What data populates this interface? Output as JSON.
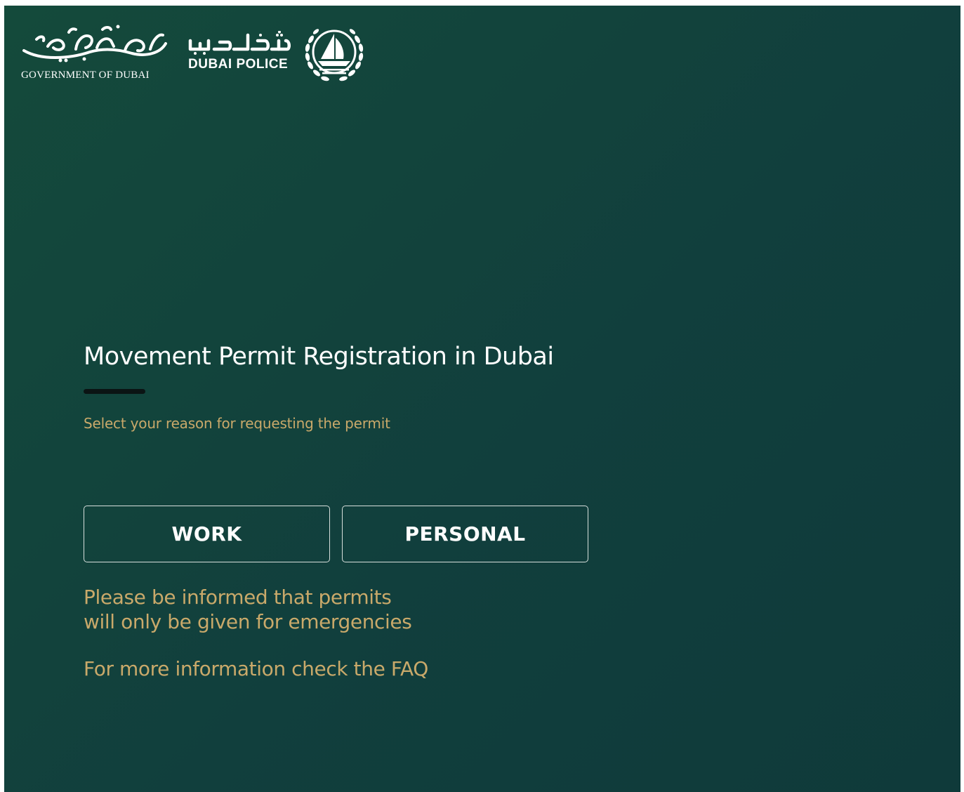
{
  "header": {
    "gov_logo_caption": "GOVERNMENT OF DUBAI",
    "gov_logo_arabic": "حكومة دبي",
    "police_logo_arabic": "شرطة دبي",
    "police_logo_caption": "DUBAI POLICE"
  },
  "main": {
    "title": "Movement Permit Registration in Dubai",
    "subtitle": "Select your reason for requesting the permit",
    "buttons": [
      {
        "label": "WORK"
      },
      {
        "label": "PERSONAL"
      }
    ],
    "notice_line1": "Please be informed that permits",
    "notice_line2": "will only be given for emergencies",
    "faq_text": "For more information check the FAQ"
  },
  "colors": {
    "background": "#124538",
    "gold_text": "#c9a96a",
    "white": "#ffffff"
  }
}
